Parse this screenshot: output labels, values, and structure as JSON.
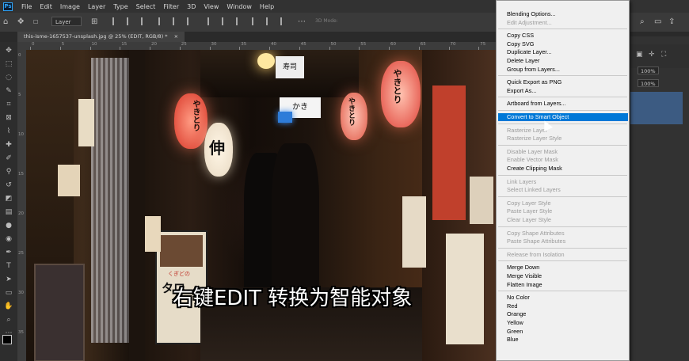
{
  "app": {
    "logo": "Ps",
    "menu": [
      "File",
      "Edit",
      "Image",
      "Layer",
      "Type",
      "Select",
      "Filter",
      "3D",
      "View",
      "Window",
      "Help"
    ]
  },
  "options_bar": {
    "layer_select": "Layer",
    "mode_3d": "3D Mode:"
  },
  "document_tab": {
    "title": "this-isme-1657537-unsplash.jpg @ 25% (EDIT, RGB/8) *",
    "close": "×"
  },
  "ruler_top_labels": [
    "0",
    "5",
    "10",
    "15",
    "20",
    "25",
    "30",
    "35",
    "40",
    "45",
    "50",
    "55",
    "60",
    "65",
    "70",
    "75"
  ],
  "ruler_left_labels": [
    "0",
    "5",
    "10",
    "15",
    "20",
    "25",
    "30",
    "35"
  ],
  "caption": "右键EDIT 转换为智能对象",
  "photo_signs": {
    "sign_1": "やきとり",
    "sign_2": "伸",
    "sign_3": "寿司",
    "sign_4": "かき",
    "sign_5": "やきとり",
    "sign_6": "やきとり",
    "sign_7": "タロ",
    "sign_8": "くぎどの"
  },
  "right_panel": {
    "opacity": "100%",
    "fill": "100%"
  },
  "context_menu": {
    "items": [
      {
        "label": "Blending Options...",
        "disabled": false
      },
      {
        "label": "Edit Adjustment...",
        "disabled": true
      },
      {
        "sep": true
      },
      {
        "label": "Copy CSS",
        "disabled": false
      },
      {
        "label": "Copy SVG",
        "disabled": false
      },
      {
        "label": "Duplicate Layer...",
        "disabled": false
      },
      {
        "label": "Delete Layer",
        "disabled": false
      },
      {
        "label": "Group from Layers...",
        "disabled": false
      },
      {
        "sep": true
      },
      {
        "label": "Quick Export as PNG",
        "disabled": false
      },
      {
        "label": "Export As...",
        "disabled": false
      },
      {
        "sep": true
      },
      {
        "label": "Artboard from Layers...",
        "disabled": false
      },
      {
        "sep": true
      },
      {
        "label": "Convert to Smart Object",
        "disabled": false,
        "highlighted": true
      },
      {
        "sep": true
      },
      {
        "label": "Rasterize Layer",
        "disabled": true
      },
      {
        "label": "Rasterize Layer Style",
        "disabled": true
      },
      {
        "sep": true
      },
      {
        "label": "Disable Layer Mask",
        "disabled": true
      },
      {
        "label": "Enable Vector Mask",
        "disabled": true
      },
      {
        "label": "Create Clipping Mask",
        "disabled": false
      },
      {
        "sep": true
      },
      {
        "label": "Link Layers",
        "disabled": true
      },
      {
        "label": "Select Linked Layers",
        "disabled": true
      },
      {
        "sep": true
      },
      {
        "label": "Copy Layer Style",
        "disabled": true
      },
      {
        "label": "Paste Layer Style",
        "disabled": true
      },
      {
        "label": "Clear Layer Style",
        "disabled": true
      },
      {
        "sep": true
      },
      {
        "label": "Copy Shape Attributes",
        "disabled": true
      },
      {
        "label": "Paste Shape Attributes",
        "disabled": true
      },
      {
        "sep": true
      },
      {
        "label": "Release from Isolation",
        "disabled": true
      },
      {
        "sep": true
      },
      {
        "label": "Merge Down",
        "disabled": false
      },
      {
        "label": "Merge Visible",
        "disabled": false
      },
      {
        "label": "Flatten Image",
        "disabled": false
      },
      {
        "sep": true
      },
      {
        "label": "No Color",
        "disabled": false
      },
      {
        "label": "Red",
        "disabled": false
      },
      {
        "label": "Orange",
        "disabled": false
      },
      {
        "label": "Yellow",
        "disabled": false
      },
      {
        "label": "Green",
        "disabled": false
      },
      {
        "label": "Blue",
        "disabled": false
      }
    ]
  },
  "colors": {
    "accent_highlight": "#0078d7",
    "panel_selection": "#3c5b82",
    "ps_blue": "#2fa3f7"
  }
}
